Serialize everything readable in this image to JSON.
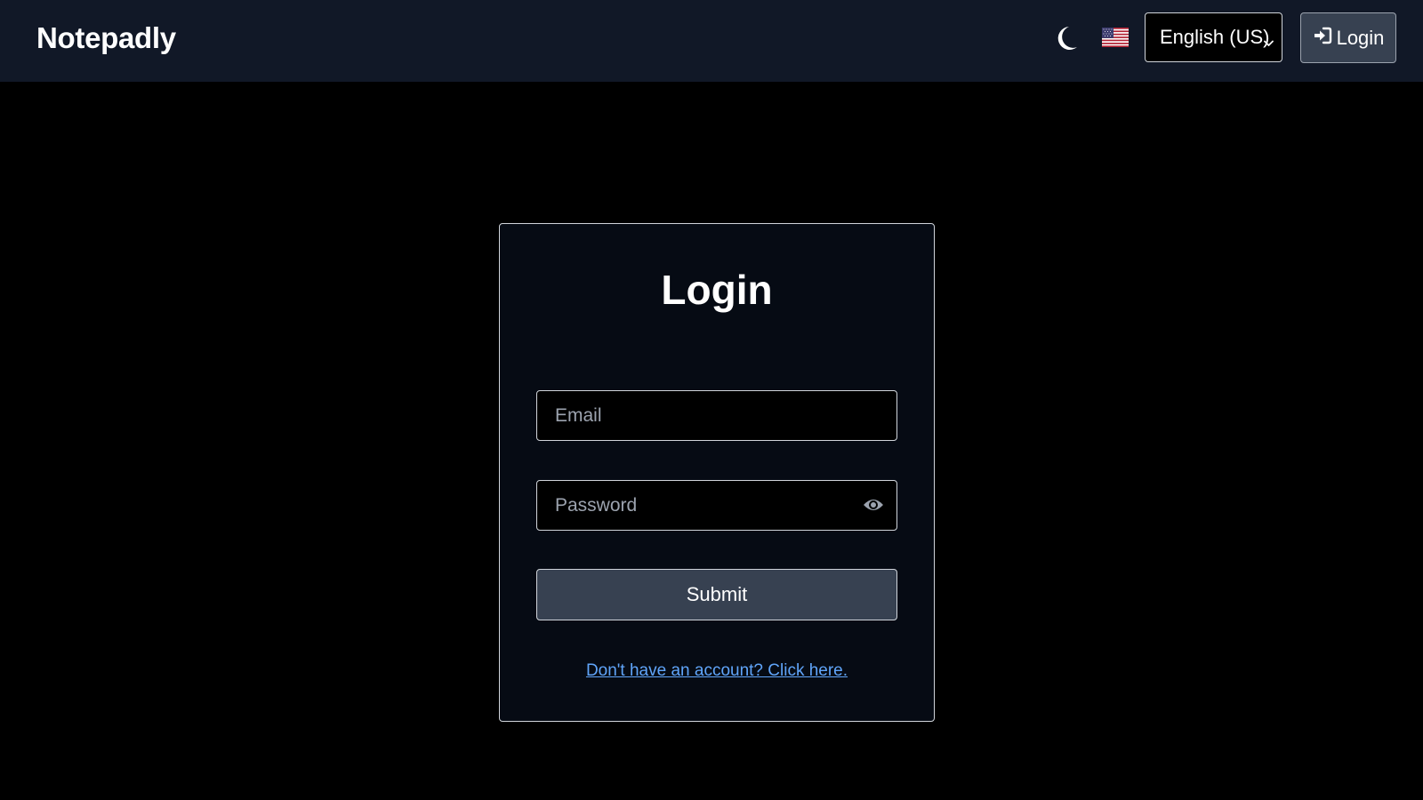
{
  "navbar": {
    "brand": "Notepadly",
    "theme_icon": "moon-icon",
    "flag_icon": "us-flag-icon",
    "language": {
      "selected": "English (US)"
    },
    "login_button": {
      "icon": "sign-in-icon",
      "label": "Login"
    }
  },
  "login_form": {
    "title": "Login",
    "email": {
      "placeholder": "Email",
      "value": ""
    },
    "password": {
      "placeholder": "Password",
      "value": "",
      "toggle_icon": "eye-icon"
    },
    "submit_label": "Submit",
    "signup_link": "Don't have an account? Click here."
  },
  "colors": {
    "navbar_bg": "#111827",
    "page_bg": "#000000",
    "button_bg": "#374151",
    "link": "#60a5fa"
  }
}
